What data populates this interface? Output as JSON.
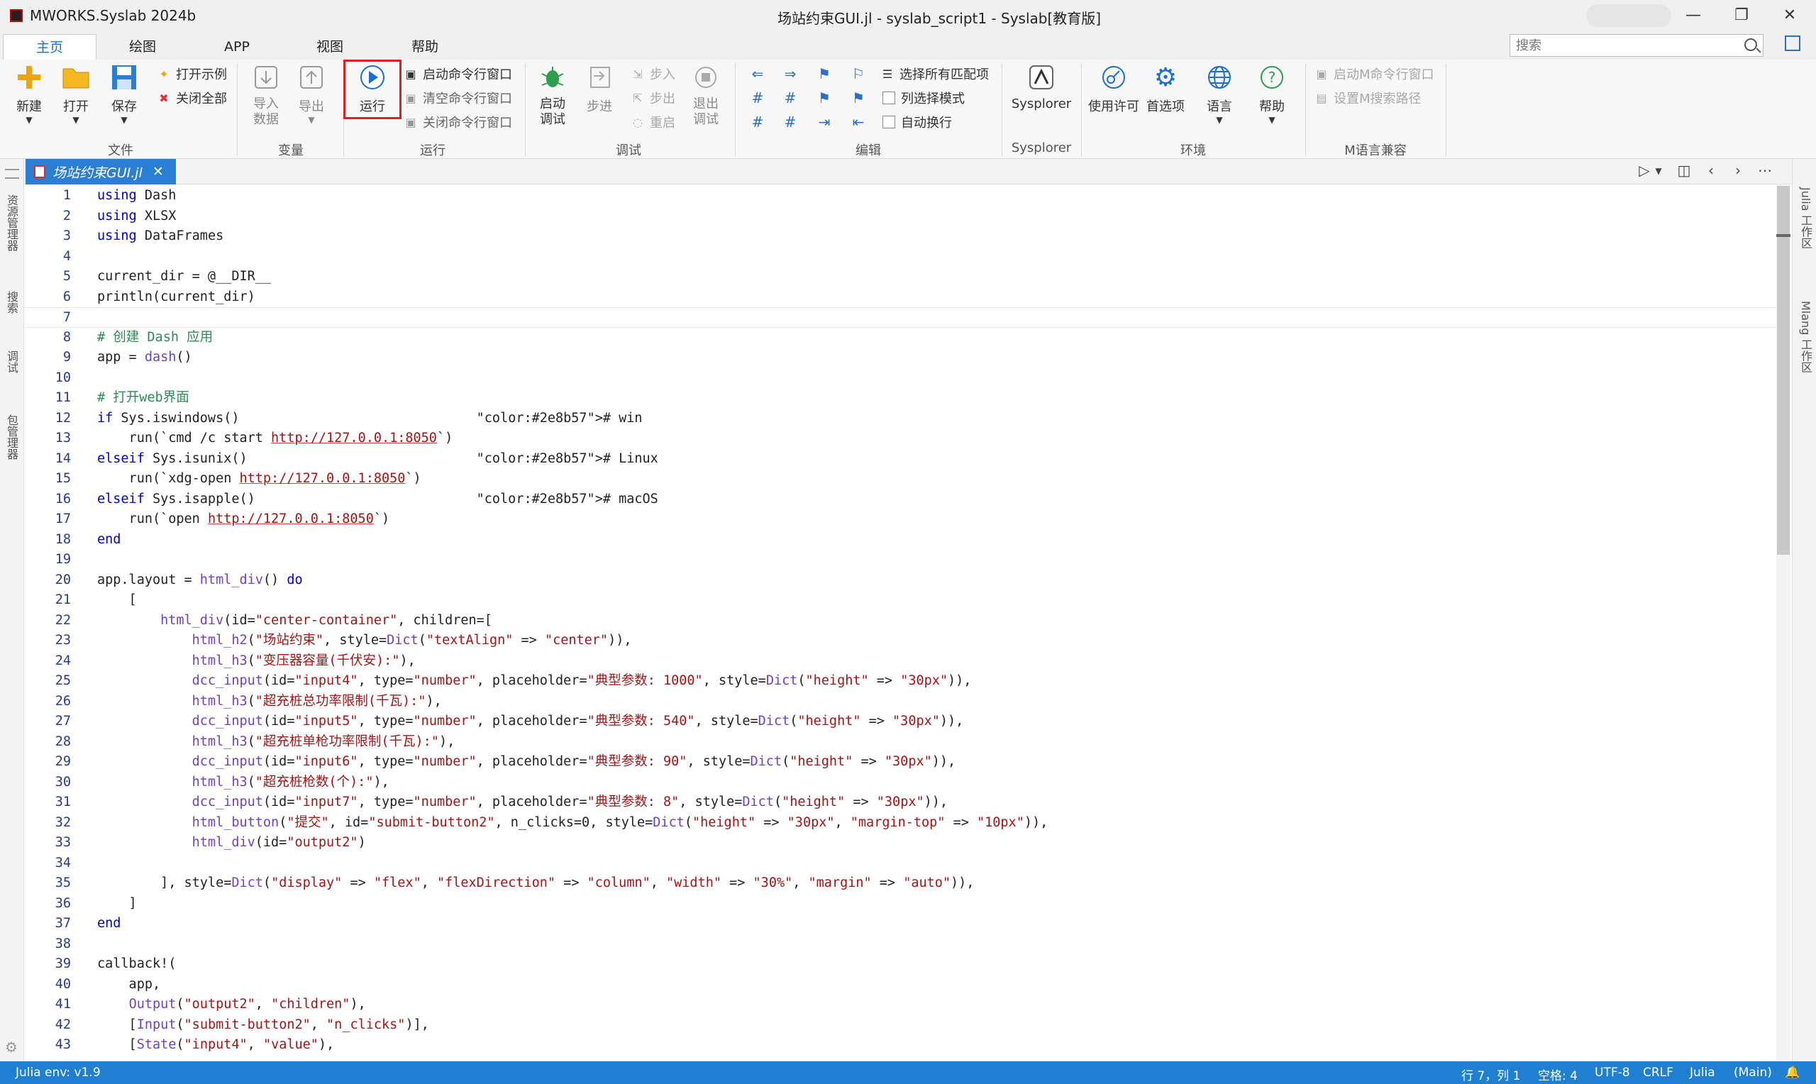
{
  "window": {
    "app_title": "MWORKS.Syslab 2024b",
    "doc_title": "场站约束GUI.jl - syslab_script1 - Syslab[教育版]",
    "minimize": "—",
    "maximize": "❐",
    "close": "✕"
  },
  "menu": {
    "tabs": [
      "主页",
      "绘图",
      "APP",
      "视图",
      "帮助"
    ]
  },
  "search": {
    "placeholder": "搜索"
  },
  "ribbon": {
    "file": {
      "label": "文件",
      "new": "新建",
      "open": "打开",
      "save": "保存",
      "open_examples": "打开示例",
      "close_all": "关闭全部"
    },
    "variable": {
      "label": "变量",
      "import": "导入\n数据",
      "export": "导出"
    },
    "run": {
      "label": "运行",
      "run": "运行",
      "start_cmd": "启动命令行窗口",
      "clear_cmd": "清空命令行窗口",
      "close_cmd": "关闭命令行窗口"
    },
    "debug": {
      "label": "调试",
      "start_debug": "启动\n调试",
      "step_over": "步进",
      "step_in": "步入",
      "step_out": "步出",
      "restart": "重启",
      "exit_debug": "退出\n调试"
    },
    "edit": {
      "label": "编辑",
      "select_all_matches": "选择所有匹配项",
      "column_mode": "列选择模式",
      "word_wrap": "自动换行"
    },
    "sysplorer": {
      "label": "Sysplorer",
      "button": "Sysplorer"
    },
    "environment": {
      "label": "环境",
      "license": "使用许可",
      "preferences": "首选项",
      "language": "语言",
      "help": "帮助"
    },
    "mlang": {
      "label": "M语言兼容",
      "start_m_cmd": "启动M命令行窗口",
      "set_m_path": "设置M搜索路径"
    }
  },
  "left_activity": [
    "资源管理器",
    "搜索",
    "调试",
    "包管理器"
  ],
  "right_activity": [
    "Julia 工作区",
    "Mlang 工作区"
  ],
  "editor": {
    "tab_title": "场站约束GUI.jl",
    "lines": [
      {
        "n": "1",
        "t": "using Dash"
      },
      {
        "n": "2",
        "t": "using XLSX"
      },
      {
        "n": "3",
        "t": "using DataFrames"
      },
      {
        "n": "4",
        "t": ""
      },
      {
        "n": "5",
        "t": "current_dir = @__DIR__"
      },
      {
        "n": "6",
        "t": "println(current_dir)"
      },
      {
        "n": "7",
        "t": ""
      },
      {
        "n": "8",
        "t": "# 创建 Dash 应用"
      },
      {
        "n": "9",
        "t": "app = dash()"
      },
      {
        "n": "10",
        "t": ""
      },
      {
        "n": "11",
        "t": "# 打开web界面"
      },
      {
        "n": "12",
        "t": "if Sys.iswindows()                              # win"
      },
      {
        "n": "13",
        "t": "    run(`cmd /c start http://127.0.0.1:8050`)"
      },
      {
        "n": "14",
        "t": "elseif Sys.isunix()                             # Linux"
      },
      {
        "n": "15",
        "t": "    run(`xdg-open http://127.0.0.1:8050`)"
      },
      {
        "n": "16",
        "t": "elseif Sys.isapple()                            # macOS"
      },
      {
        "n": "17",
        "t": "    run(`open http://127.0.0.1:8050`)"
      },
      {
        "n": "18",
        "t": "end"
      },
      {
        "n": "19",
        "t": ""
      },
      {
        "n": "20",
        "t": "app.layout = html_div() do"
      },
      {
        "n": "21",
        "t": "    ["
      },
      {
        "n": "22",
        "t": "        html_div(id=\"center-container\", children=["
      },
      {
        "n": "23",
        "t": "            html_h2(\"场站约束\", style=Dict(\"textAlign\" => \"center\")),"
      },
      {
        "n": "24",
        "t": "            html_h3(\"变压器容量(千伏安):\"),"
      },
      {
        "n": "25",
        "t": "            dcc_input(id=\"input4\", type=\"number\", placeholder=\"典型参数: 1000\", style=Dict(\"height\" => \"30px\")),"
      },
      {
        "n": "26",
        "t": "            html_h3(\"超充桩总功率限制(千瓦):\"),"
      },
      {
        "n": "27",
        "t": "            dcc_input(id=\"input5\", type=\"number\", placeholder=\"典型参数: 540\", style=Dict(\"height\" => \"30px\")),"
      },
      {
        "n": "28",
        "t": "            html_h3(\"超充桩单枪功率限制(千瓦):\"),"
      },
      {
        "n": "29",
        "t": "            dcc_input(id=\"input6\", type=\"number\", placeholder=\"典型参数: 90\", style=Dict(\"height\" => \"30px\")),"
      },
      {
        "n": "30",
        "t": "            html_h3(\"超充桩枪数(个):\"),"
      },
      {
        "n": "31",
        "t": "            dcc_input(id=\"input7\", type=\"number\", placeholder=\"典型参数: 8\", style=Dict(\"height\" => \"30px\")),"
      },
      {
        "n": "32",
        "t": "            html_button(\"提交\", id=\"submit-button2\", n_clicks=0, style=Dict(\"height\" => \"30px\", \"margin-top\" => \"10px\")),"
      },
      {
        "n": "33",
        "t": "            html_div(id=\"output2\")"
      },
      {
        "n": "34",
        "t": ""
      },
      {
        "n": "35",
        "t": "        ], style=Dict(\"display\" => \"flex\", \"flexDirection\" => \"column\", \"width\" => \"30%\", \"margin\" => \"auto\")),"
      },
      {
        "n": "36",
        "t": "    ]"
      },
      {
        "n": "37",
        "t": "end"
      },
      {
        "n": "38",
        "t": ""
      },
      {
        "n": "39",
        "t": "callback!("
      },
      {
        "n": "40",
        "t": "    app,"
      },
      {
        "n": "41",
        "t": "    Output(\"output2\", \"children\"),"
      },
      {
        "n": "42",
        "t": "    [Input(\"submit-button2\", \"n_clicks\")],"
      },
      {
        "n": "43",
        "t": "    [State(\"input4\", \"value\"),"
      }
    ]
  },
  "status": {
    "env": "Julia env: v1.9",
    "position": "行 7，列 1",
    "spaces": "空格: 4",
    "encoding": "UTF-8",
    "eol": "CRLF",
    "language": "Julia",
    "branch": "(Main)"
  }
}
